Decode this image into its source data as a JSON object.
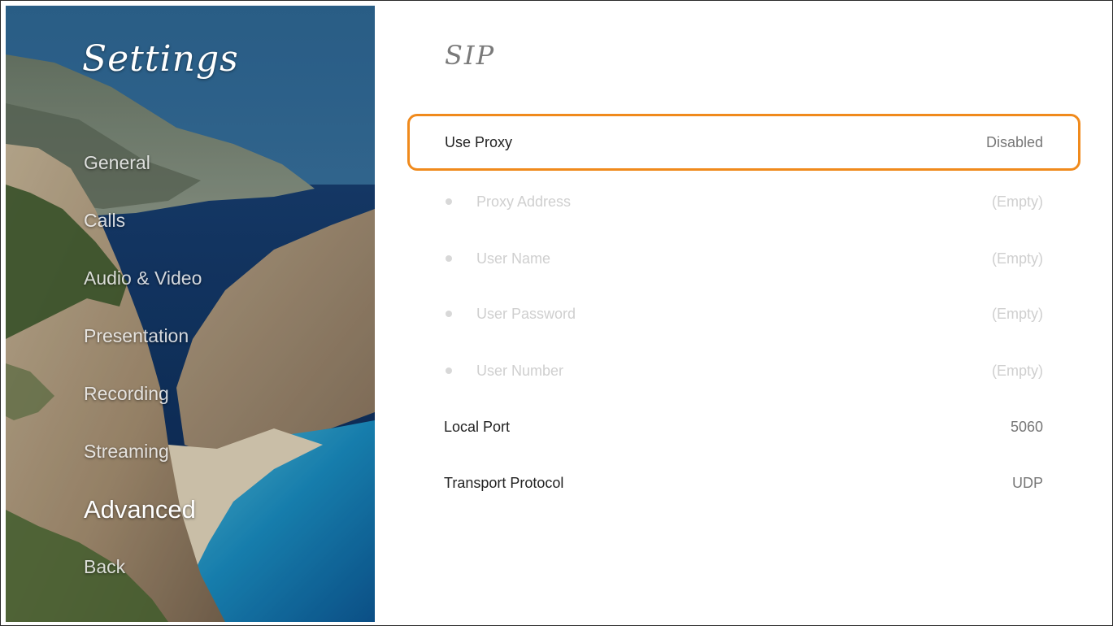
{
  "sidebar": {
    "title": "Settings",
    "items": [
      {
        "label": "General"
      },
      {
        "label": "Calls"
      },
      {
        "label": "Audio & Video"
      },
      {
        "label": "Presentation"
      },
      {
        "label": "Recording"
      },
      {
        "label": "Streaming"
      },
      {
        "label": "Advanced"
      },
      {
        "label": "Back"
      }
    ],
    "active_item": "Advanced"
  },
  "main": {
    "title": "SIP",
    "settings": [
      {
        "label": "Use Proxy",
        "value": "Disabled",
        "state": "selected"
      },
      {
        "label": "Proxy Address",
        "value": "(Empty)",
        "state": "disabled"
      },
      {
        "label": "User Name",
        "value": "(Empty)",
        "state": "disabled"
      },
      {
        "label": "User Password",
        "value": "(Empty)",
        "state": "disabled"
      },
      {
        "label": "User Number",
        "value": "(Empty)",
        "state": "disabled"
      },
      {
        "label": "Local Port",
        "value": "5060",
        "state": "normal"
      },
      {
        "label": "Transport Protocol",
        "value": "UDP",
        "state": "normal"
      }
    ]
  },
  "colors": {
    "focus_border": "#f08a1c",
    "label_text": "#222222",
    "value_text": "#777777",
    "disabled_text": "#cfcfcf"
  }
}
